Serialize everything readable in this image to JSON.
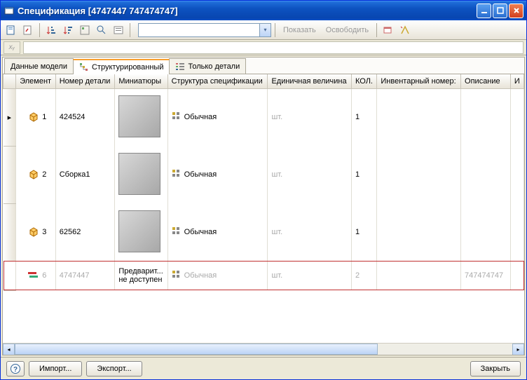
{
  "window": {
    "title": "Спецификация [4747447 747474747]"
  },
  "toolbar": {
    "show_label": "Показать",
    "release_label": "Освободить"
  },
  "tabs": [
    {
      "label": "Данные модели"
    },
    {
      "label": "Структурированный"
    },
    {
      "label": "Только детали"
    }
  ],
  "active_tab": 1,
  "columns": {
    "element": "Элемент",
    "part_no": "Номер детали",
    "thumb": "Миниатюры",
    "struct": "Структура спецификации",
    "unit": "Единичная величина",
    "qty": "КОЛ.",
    "inv_no": "Инвентарный номер:",
    "descr": "Описание",
    "last": "И"
  },
  "struct_value": "Обычная",
  "rows": [
    {
      "element": "1",
      "part_no": "424524",
      "thumb": "shape",
      "unit": "шт.",
      "qty": "1",
      "inv": "",
      "descr": "",
      "selected": false
    },
    {
      "element": "2",
      "part_no": "Сборка1",
      "thumb": "shape",
      "unit": "шт.",
      "qty": "1",
      "inv": "",
      "descr": "",
      "selected": false
    },
    {
      "element": "3",
      "part_no": "62562",
      "thumb": "shape",
      "unit": "шт.",
      "qty": "1",
      "inv": "",
      "descr": "",
      "selected": false
    },
    {
      "element": "6",
      "part_no": "4747447",
      "thumb": "na",
      "thumb_text": "Предварит... не доступен",
      "unit": "шт.",
      "qty": "2",
      "inv": "",
      "descr": "747474747",
      "selected": true
    }
  ],
  "footer": {
    "help": "?",
    "import": "Импорт...",
    "export": "Экспорт...",
    "close": "Закрыть"
  },
  "colors": {
    "titlebar": "#0d52c0",
    "accent_tab": "#f8a030",
    "selected_row_border": "#c03030"
  }
}
